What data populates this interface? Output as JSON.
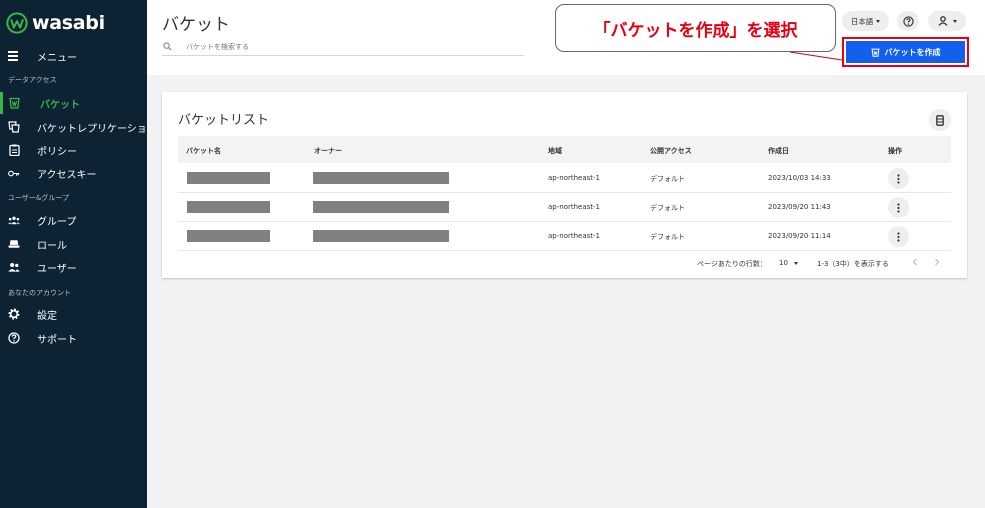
{
  "brand": {
    "name": "wasabi"
  },
  "sidebar": {
    "menu_label": "メニュー",
    "sections": {
      "data_access": "データアクセス",
      "users_groups": "ユーザー&グループ",
      "your_account": "あなたのアカウント"
    },
    "items": [
      {
        "label": "バケット",
        "icon": "bucket-icon",
        "active": true
      },
      {
        "label": "バケットレプリケーション",
        "icon": "replication-icon"
      },
      {
        "label": "ポリシー",
        "icon": "policy-icon"
      },
      {
        "label": "アクセスキー",
        "icon": "key-icon"
      },
      {
        "label": "グループ",
        "icon": "group-icon"
      },
      {
        "label": "ロール",
        "icon": "role-icon"
      },
      {
        "label": "ユーザー",
        "icon": "users-icon"
      },
      {
        "label": "設定",
        "icon": "gear-icon"
      },
      {
        "label": "サポート",
        "icon": "help-icon"
      }
    ]
  },
  "header": {
    "title": "バケット",
    "search_placeholder": "バケットを検索する",
    "language": "日本語",
    "create_button": "バケットを作成"
  },
  "annotation": {
    "callout": "「バケットを作成」を選択",
    "color": "#e60012"
  },
  "bucket_list": {
    "title": "バケットリスト",
    "columns": [
      "バケット名",
      "オーナー",
      "地域",
      "公開アクセス",
      "作成日",
      "操作"
    ],
    "rows": [
      {
        "region": "ap-northeast-1",
        "access": "デフォルト",
        "created": "2023/10/03 14:33"
      },
      {
        "region": "ap-northeast-1",
        "access": "デフォルト",
        "created": "2023/09/20 11:43"
      },
      {
        "region": "ap-northeast-1",
        "access": "デフォルト",
        "created": "2023/09/20 11:14"
      }
    ],
    "pagination": {
      "rows_per_page_label": "ページあたりの行数：",
      "rows_per_page": "10",
      "range": "1-3（3中）を表示する"
    }
  },
  "colors": {
    "sidebar_bg": "#0d2233",
    "accent_green": "#3bb54a",
    "primary_blue": "#1460ee"
  }
}
